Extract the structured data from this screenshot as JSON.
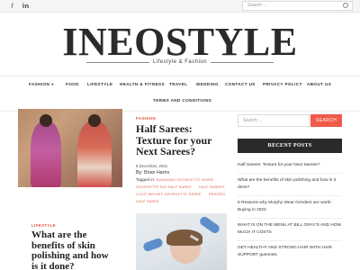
{
  "topbar": {
    "social": [
      "facebook-icon",
      "linkedin-icon"
    ],
    "facebook_glyph": "f",
    "linkedin_glyph": "in",
    "search_placeholder": "Search ..."
  },
  "site": {
    "logo": "INEOSTYLE",
    "tagline": "Lifestyle & Fashion"
  },
  "nav": {
    "items": [
      "FASHION",
      "FOOD",
      "LIFESTYLE",
      "HEALTH & FITNESS",
      "TRAVEL",
      "WEDDING",
      "CONTACT US",
      "PRIVACY POLICY",
      "ABOUT US",
      "TERMS AND CONDITIONS"
    ],
    "caret": "▾"
  },
  "posts": [
    {
      "category": "FASHION",
      "title_lines": [
        "Half Sarees:",
        "Texture for your",
        "Next Sarees?"
      ],
      "date": "8 December, 2021",
      "author": "By: Brian Harris",
      "tags_label": "Tagged in:",
      "tags": [
        "BANARASI GEORGETTE SAREE",
        "GEORGETTE BIG HALF SAREE",
        "HALF SAREES",
        "LIGHT WEIGHT GEORGETTE SAREE",
        "PRINTED",
        "HALF SAREE"
      ]
    },
    {
      "category": "LIFESTYLE",
      "title_lines": [
        "What are the",
        "benefits of skin",
        "polishing and how",
        "is it done?"
      ]
    }
  ],
  "sidebar": {
    "search_placeholder": "Search ...",
    "search_button": "SEARCH",
    "recent_title": "RECENT POSTS",
    "recent_posts": [
      "Half Sarees: Texture for your Next Sarees?",
      "What are the benefits of skin polishing and how is it done?",
      "5 Reasons why Morphy Wear Grinders are worth Buying in 2022",
      "WHAT IS ON THE MENU AT BILL GRAY'S AND HOW MUCH IT COSTS",
      "GET HEALTHY AND STRONG HAIR WITH HAIR SUPPORT gummies"
    ]
  },
  "colors": {
    "accent": "#ef5a4a",
    "category": "#e05a47",
    "dark": "#2a2a2a"
  }
}
